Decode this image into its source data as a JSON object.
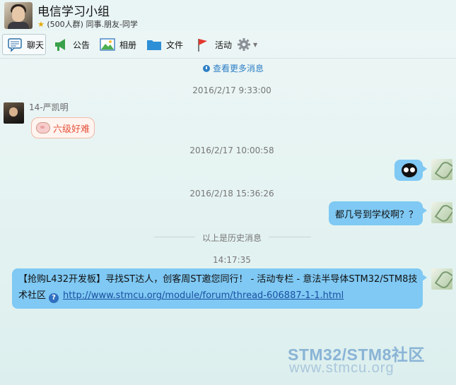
{
  "header": {
    "title": "电信学习小组",
    "member_count": "(500人群)",
    "tags": "同事.朋友-同学"
  },
  "toolbar": {
    "chat": "聊天",
    "notice": "公告",
    "album": "相册",
    "files": "文件",
    "activity": "活动"
  },
  "messages": {
    "more_link": "查看更多消息",
    "ts1": "2016/2/17 9:33:00",
    "sender1": "14-严凯明",
    "msg1": "六级好难",
    "ts2": "2016/2/17 10:00:58",
    "ts3": "2016/2/18 15:36:26",
    "msg3": "都几号到学校啊？？",
    "history_label": "以上是历史消息",
    "ts4": "14:17:35",
    "msg4_text": "【抢购L432开发板】寻找ST达人，创客周ST邀您同行！ - 活动专栏 - 意法半导体STM32/STM8技术社区",
    "msg4_link": "http://www.stmcu.org/module/forum/thread-606887-1-1.html"
  },
  "watermark": {
    "line1": "STM32/STM8社区",
    "line2": "www.stmcu.org"
  },
  "colors": {
    "bubble_out": "#7fc9f4",
    "link": "#1b4fa0",
    "accent": "#2d7fc6"
  }
}
